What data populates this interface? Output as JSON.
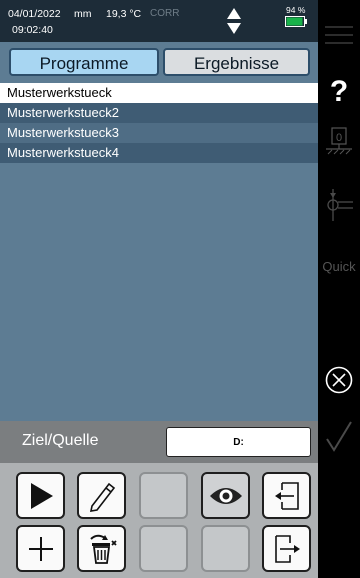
{
  "status": {
    "date": "04/01/2022",
    "time": "09:02:40",
    "unit": "mm",
    "temperature": "19,3 °C",
    "corr": "CORR",
    "battery": "94 %",
    "battery_level": 0.94
  },
  "tabs": {
    "programme": "Programme",
    "ergebnisse": "Ergebnisse"
  },
  "list": {
    "items": [
      "Musterwerkstueck",
      "Musterwerkstueck2",
      "Musterwerkstueck3",
      "Musterwerkstueck4"
    ]
  },
  "target": {
    "label": "Ziel/Quelle",
    "value": "D:"
  },
  "sidebar": {
    "quick": "Quick",
    "icons": [
      "menu-icon",
      "help-icon",
      "zero-icon",
      "probe-icon",
      "quick-label",
      "cancel-icon",
      "confirm-icon"
    ]
  },
  "toolbar": {
    "icons": [
      "play-icon",
      "edit-icon",
      "blank",
      "view-icon",
      "import-icon",
      "add-icon",
      "delete-icon",
      "blank",
      "blank",
      "export-icon"
    ]
  },
  "colors": {
    "panel": "#5d7c93",
    "status_bar": "#1d2c38",
    "tab_active": "#a8d6f2",
    "battery": "#19b34a"
  }
}
